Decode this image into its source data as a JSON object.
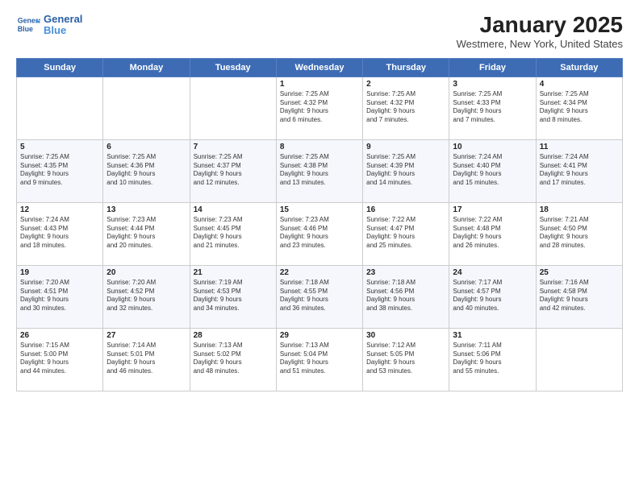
{
  "logo": {
    "text_line1": "General",
    "text_line2": "Blue"
  },
  "header": {
    "month_year": "January 2025",
    "location": "Westmere, New York, United States"
  },
  "weekdays": [
    "Sunday",
    "Monday",
    "Tuesday",
    "Wednesday",
    "Thursday",
    "Friday",
    "Saturday"
  ],
  "weeks": [
    [
      {
        "day": "",
        "details": ""
      },
      {
        "day": "",
        "details": ""
      },
      {
        "day": "",
        "details": ""
      },
      {
        "day": "1",
        "details": "Sunrise: 7:25 AM\nSunset: 4:32 PM\nDaylight: 9 hours\nand 6 minutes."
      },
      {
        "day": "2",
        "details": "Sunrise: 7:25 AM\nSunset: 4:32 PM\nDaylight: 9 hours\nand 7 minutes."
      },
      {
        "day": "3",
        "details": "Sunrise: 7:25 AM\nSunset: 4:33 PM\nDaylight: 9 hours\nand 7 minutes."
      },
      {
        "day": "4",
        "details": "Sunrise: 7:25 AM\nSunset: 4:34 PM\nDaylight: 9 hours\nand 8 minutes."
      }
    ],
    [
      {
        "day": "5",
        "details": "Sunrise: 7:25 AM\nSunset: 4:35 PM\nDaylight: 9 hours\nand 9 minutes."
      },
      {
        "day": "6",
        "details": "Sunrise: 7:25 AM\nSunset: 4:36 PM\nDaylight: 9 hours\nand 10 minutes."
      },
      {
        "day": "7",
        "details": "Sunrise: 7:25 AM\nSunset: 4:37 PM\nDaylight: 9 hours\nand 12 minutes."
      },
      {
        "day": "8",
        "details": "Sunrise: 7:25 AM\nSunset: 4:38 PM\nDaylight: 9 hours\nand 13 minutes."
      },
      {
        "day": "9",
        "details": "Sunrise: 7:25 AM\nSunset: 4:39 PM\nDaylight: 9 hours\nand 14 minutes."
      },
      {
        "day": "10",
        "details": "Sunrise: 7:24 AM\nSunset: 4:40 PM\nDaylight: 9 hours\nand 15 minutes."
      },
      {
        "day": "11",
        "details": "Sunrise: 7:24 AM\nSunset: 4:41 PM\nDaylight: 9 hours\nand 17 minutes."
      }
    ],
    [
      {
        "day": "12",
        "details": "Sunrise: 7:24 AM\nSunset: 4:43 PM\nDaylight: 9 hours\nand 18 minutes."
      },
      {
        "day": "13",
        "details": "Sunrise: 7:23 AM\nSunset: 4:44 PM\nDaylight: 9 hours\nand 20 minutes."
      },
      {
        "day": "14",
        "details": "Sunrise: 7:23 AM\nSunset: 4:45 PM\nDaylight: 9 hours\nand 21 minutes."
      },
      {
        "day": "15",
        "details": "Sunrise: 7:23 AM\nSunset: 4:46 PM\nDaylight: 9 hours\nand 23 minutes."
      },
      {
        "day": "16",
        "details": "Sunrise: 7:22 AM\nSunset: 4:47 PM\nDaylight: 9 hours\nand 25 minutes."
      },
      {
        "day": "17",
        "details": "Sunrise: 7:22 AM\nSunset: 4:48 PM\nDaylight: 9 hours\nand 26 minutes."
      },
      {
        "day": "18",
        "details": "Sunrise: 7:21 AM\nSunset: 4:50 PM\nDaylight: 9 hours\nand 28 minutes."
      }
    ],
    [
      {
        "day": "19",
        "details": "Sunrise: 7:20 AM\nSunset: 4:51 PM\nDaylight: 9 hours\nand 30 minutes."
      },
      {
        "day": "20",
        "details": "Sunrise: 7:20 AM\nSunset: 4:52 PM\nDaylight: 9 hours\nand 32 minutes."
      },
      {
        "day": "21",
        "details": "Sunrise: 7:19 AM\nSunset: 4:53 PM\nDaylight: 9 hours\nand 34 minutes."
      },
      {
        "day": "22",
        "details": "Sunrise: 7:18 AM\nSunset: 4:55 PM\nDaylight: 9 hours\nand 36 minutes."
      },
      {
        "day": "23",
        "details": "Sunrise: 7:18 AM\nSunset: 4:56 PM\nDaylight: 9 hours\nand 38 minutes."
      },
      {
        "day": "24",
        "details": "Sunrise: 7:17 AM\nSunset: 4:57 PM\nDaylight: 9 hours\nand 40 minutes."
      },
      {
        "day": "25",
        "details": "Sunrise: 7:16 AM\nSunset: 4:58 PM\nDaylight: 9 hours\nand 42 minutes."
      }
    ],
    [
      {
        "day": "26",
        "details": "Sunrise: 7:15 AM\nSunset: 5:00 PM\nDaylight: 9 hours\nand 44 minutes."
      },
      {
        "day": "27",
        "details": "Sunrise: 7:14 AM\nSunset: 5:01 PM\nDaylight: 9 hours\nand 46 minutes."
      },
      {
        "day": "28",
        "details": "Sunrise: 7:13 AM\nSunset: 5:02 PM\nDaylight: 9 hours\nand 48 minutes."
      },
      {
        "day": "29",
        "details": "Sunrise: 7:13 AM\nSunset: 5:04 PM\nDaylight: 9 hours\nand 51 minutes."
      },
      {
        "day": "30",
        "details": "Sunrise: 7:12 AM\nSunset: 5:05 PM\nDaylight: 9 hours\nand 53 minutes."
      },
      {
        "day": "31",
        "details": "Sunrise: 7:11 AM\nSunset: 5:06 PM\nDaylight: 9 hours\nand 55 minutes."
      },
      {
        "day": "",
        "details": ""
      }
    ]
  ]
}
